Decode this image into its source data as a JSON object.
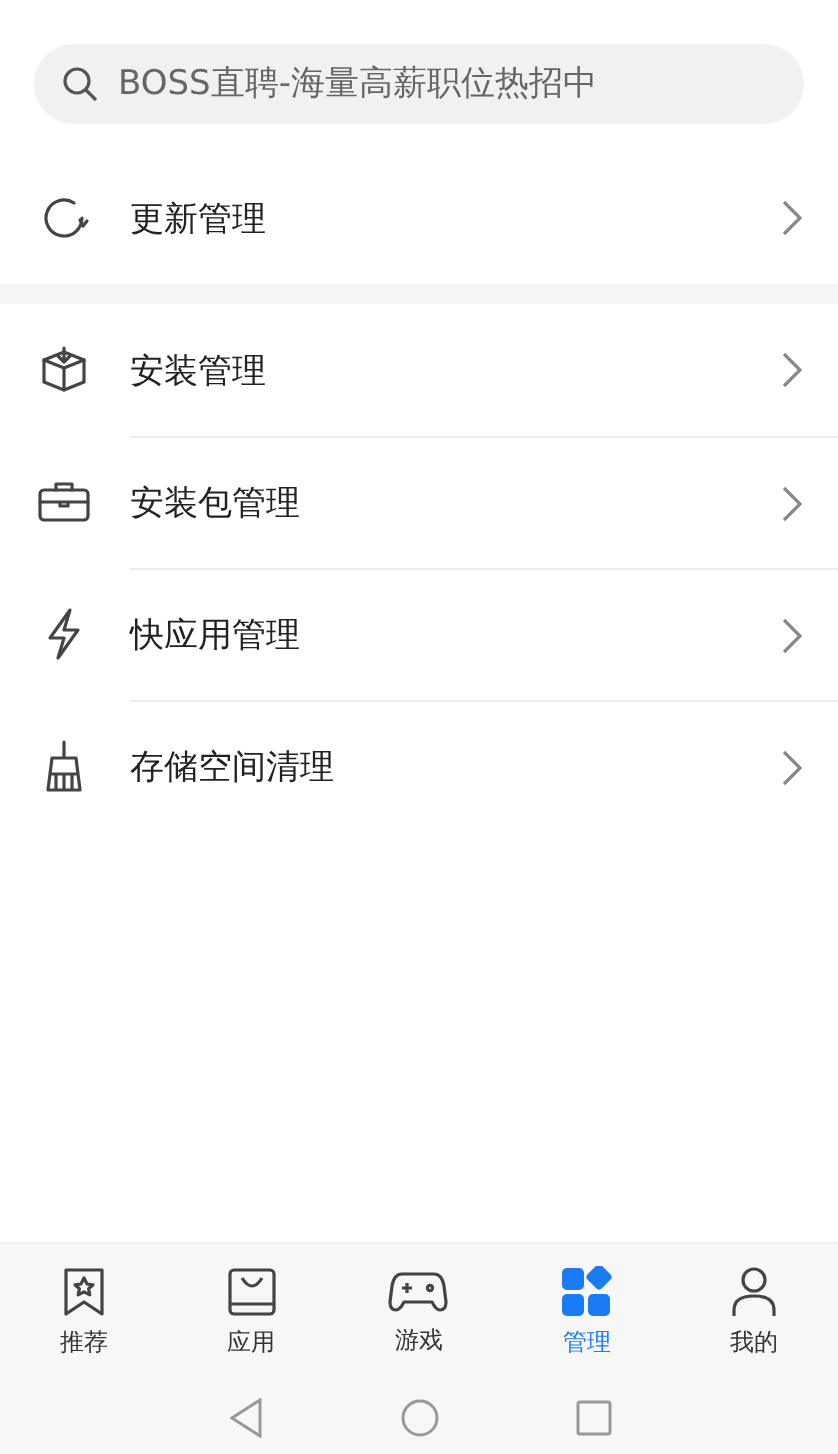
{
  "search": {
    "placeholder": "BOSS直聘-海量高薪职位热招中"
  },
  "top_item": {
    "kind": "refresh",
    "label": "更新管理"
  },
  "items": [
    {
      "kind": "install",
      "label": "安装管理"
    },
    {
      "kind": "package",
      "label": "安装包管理"
    },
    {
      "kind": "quickapp",
      "label": "快应用管理"
    },
    {
      "kind": "storage",
      "label": "存储空间清理"
    }
  ],
  "tabs": [
    {
      "kind": "recommend",
      "label": "推荐",
      "selected": false
    },
    {
      "kind": "apps",
      "label": "应用",
      "selected": false
    },
    {
      "kind": "games",
      "label": "游戏",
      "selected": false
    },
    {
      "kind": "manage",
      "label": "管理",
      "selected": true
    },
    {
      "kind": "mine",
      "label": "我的",
      "selected": false
    }
  ]
}
